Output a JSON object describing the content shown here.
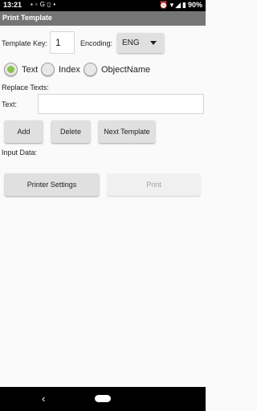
{
  "status_bar": {
    "time": "13:21",
    "icons": [
      "image-icon",
      "notification-icon",
      "google-icon",
      "clipboard-icon",
      "dot-icon",
      "alarm-icon",
      "wifi-icon",
      "signal-icon",
      "battery-icon"
    ],
    "battery": "90%"
  },
  "title_bar": {
    "title": "Print Template"
  },
  "form": {
    "template_key_label": "Template Key:",
    "template_key_value": "1",
    "encoding_label": "Encoding:",
    "encoding_value": "ENG",
    "radio_options": [
      {
        "label": "Text",
        "selected": true
      },
      {
        "label": "Index",
        "selected": false
      },
      {
        "label": "ObjectName",
        "selected": false
      }
    ],
    "replace_texts_label": "Replace Texts:",
    "text_label": "Text:",
    "text_value": "",
    "input_data_label": "Input Data:"
  },
  "buttons": {
    "add": "Add",
    "delete": "Delete",
    "next_template": "Next Template",
    "printer_settings": "Printer Settings",
    "print": "Print"
  },
  "colors": {
    "title_bar": "#757575",
    "radio_selected": "#8bc34a",
    "button": "#e0e0e0",
    "status_bar": "#000000"
  }
}
